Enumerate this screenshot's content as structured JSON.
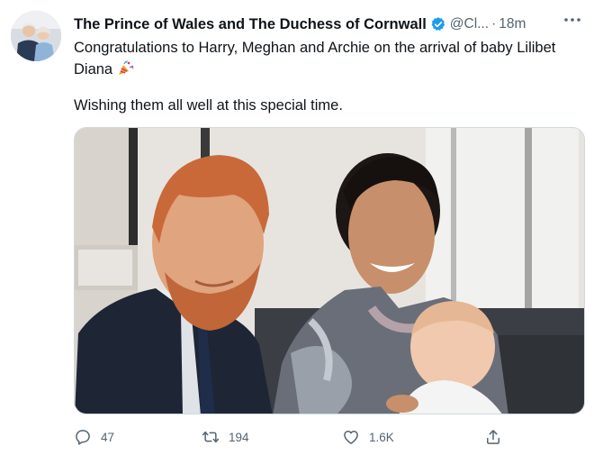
{
  "tweet": {
    "author_name": "The Prince of Wales and The Duchess of Cornwall",
    "handle": "@Cl...",
    "separator": "·",
    "time": "18m",
    "text_line1": "Congratulations to Harry, Meghan and Archie on the arrival of baby Lilibet",
    "text_line1b": "Diana",
    "text_line2": "Wishing them all well at this special time."
  },
  "actions": {
    "replies": "47",
    "retweets": "194",
    "likes": "1.6K"
  },
  "icons": {
    "verified": "verified-badge-icon",
    "more": "more-dots-icon",
    "reply": "reply-icon",
    "retweet": "retweet-icon",
    "like": "heart-icon",
    "share": "share-icon",
    "emoji": "party-popper-emoji"
  },
  "colors": {
    "verified": "#1d9bf0",
    "secondary_text": "#536471",
    "primary_text": "#0f1419"
  }
}
